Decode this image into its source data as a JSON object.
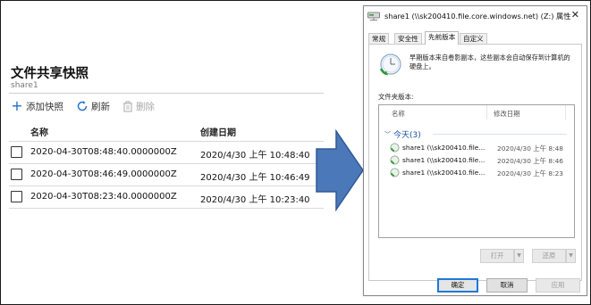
{
  "portal": {
    "title": "文件共享快照",
    "subtitle": "share1",
    "toolbar": {
      "add_label": "添加快照",
      "refresh_label": "刷新",
      "delete_label": "删除"
    },
    "table": {
      "headers": {
        "name": "名称",
        "date": "创建日期"
      },
      "rows": [
        {
          "name": "2020-04-30T08:48:40.0000000Z",
          "date": "2020/4/30 上午 10:48:40"
        },
        {
          "name": "2020-04-30T08:46:49.0000000Z",
          "date": "2020/4/30 上午 10:46:49"
        },
        {
          "name": "2020-04-30T08:23:40.0000000Z",
          "date": "2020/4/30 上午 10:23:40"
        }
      ]
    }
  },
  "dialog": {
    "title": "share1 (\\\\sk200410.file.core.windows.net) (Z:) 属性",
    "close": "✕",
    "tabs": [
      {
        "label": "常规"
      },
      {
        "label": "安全性"
      },
      {
        "label": "先前版本"
      },
      {
        "label": "自定义"
      }
    ],
    "description": "早期版本来自卷影副本，这些副本会自动保存到计算机的硬盘上。",
    "folder_versions_label": "文件夹版本:",
    "list": {
      "col_name": "名称",
      "col_date": "修改日期",
      "group": "今天(3)",
      "items": [
        {
          "name": "share1 (\\\\sk200410.file...",
          "date": "2020/4/30 上午 8:48"
        },
        {
          "name": "share1 (\\\\sk200410.file...",
          "date": "2020/4/30 上午 8:46"
        },
        {
          "name": "share1 (\\\\sk200410.file...",
          "date": "2020/4/30 上午 8:23"
        }
      ]
    },
    "buttons": {
      "open": "打开",
      "restore": "还原",
      "ok": "确定",
      "cancel": "取消",
      "apply": "应用"
    }
  },
  "colors": {
    "arrow_fill": "#4a78b8",
    "arrow_stroke": "#2f5a95",
    "accent": "#1f6fc5"
  }
}
